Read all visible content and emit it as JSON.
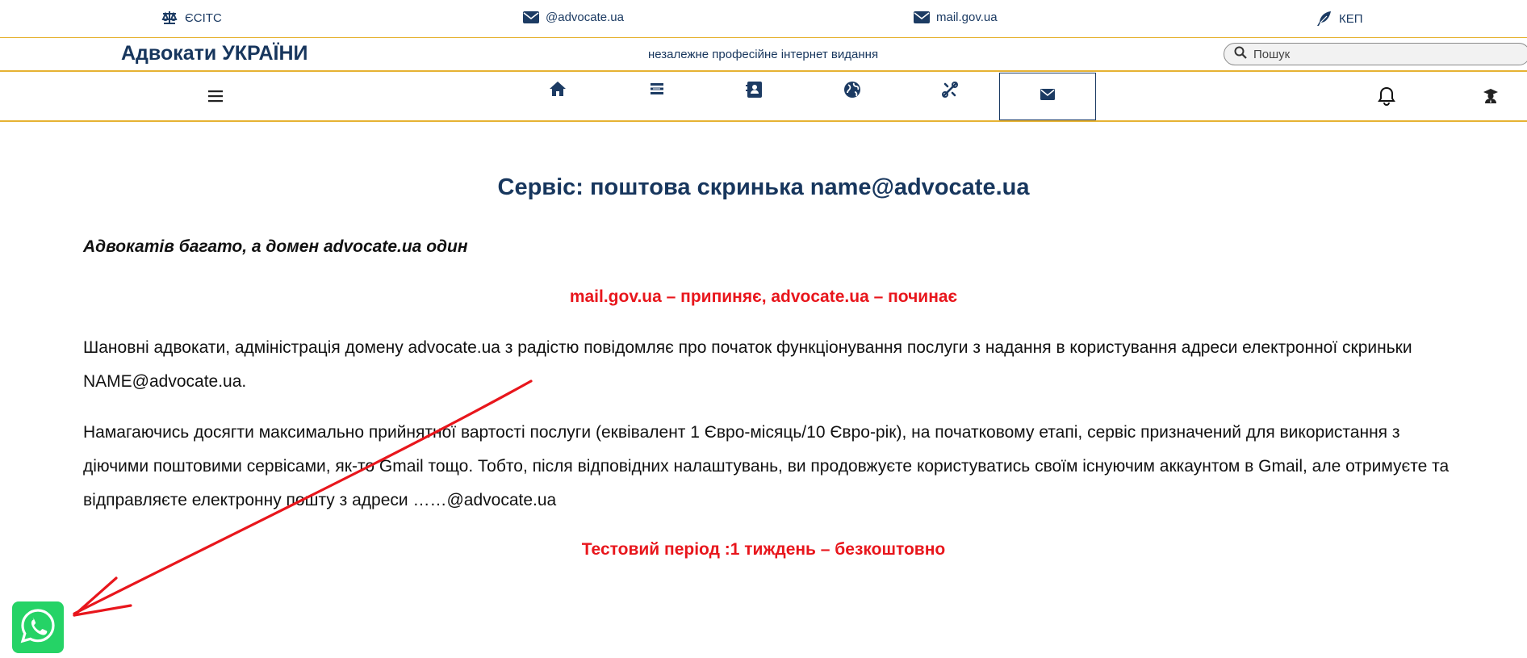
{
  "topbar": {
    "links": [
      {
        "icon": "scales-icon",
        "label": "ЄСІТС"
      },
      {
        "icon": "envelope-icon",
        "label": "@advocate.ua"
      },
      {
        "icon": "envelope-icon",
        "label": "mail.gov.ua"
      },
      {
        "icon": "feather-icon",
        "label": "КЕП"
      }
    ]
  },
  "header": {
    "brand": "Адвокати УКРАЇНИ",
    "tagline": "незалежне професійне інтернет видання",
    "search_placeholder": "Пошук"
  },
  "nav": {
    "icons": [
      "menu-icon",
      "home-icon",
      "news-icon",
      "contacts-icon",
      "globe-icon",
      "tools-icon",
      "mail-icon",
      "bell-icon",
      "user-graduate-icon"
    ],
    "active": "mail-icon"
  },
  "content": {
    "title": "Сервіс: поштова скринька name@advocate.ua",
    "lead": "Адвокатів багато, а домен advocate.ua один",
    "slogan": "mail.gov.ua – припиняє, advocate.ua – починає",
    "para1": "Шановні адвокати, адміністрація домену advocate.ua з радістю повідомляє про початок функціонування  послуги  з надання в користування адреси електронної скриньки NAME@advocate.ua.",
    "para2": "Намагаючись досягти максимально прийнятної вартості послуги (еквівалент 1 Євро-місяць/10 Євро-рік), на початковому етапі, сервіс призначений для використання з діючими поштовими сервісами, як-то  Gmail  тощо. Тобто, після відповідних налаштувань, ви продовжуєте користуватись своїм існуючим аккаунтом в Gmail, але отримуєте та відправляєте  електронну пошту з адреси ……@advocate.ua",
    "trial": "Тестовий період :1 тиждень – безкоштовно"
  },
  "widgets": {
    "whatsapp_icon": "whatsapp-icon",
    "annotation_color": "#e8161c"
  },
  "colors": {
    "accent": "#e6b233",
    "brand": "#17365d",
    "highlight": "#e8161c",
    "whatsapp": "#25d366"
  }
}
